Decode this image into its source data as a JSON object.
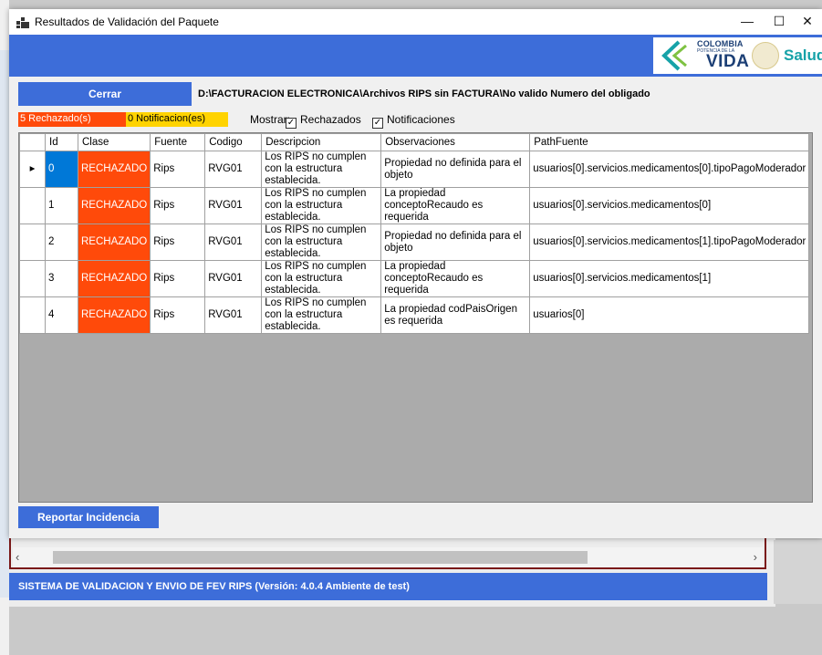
{
  "window": {
    "title": "Resultados de Validación del Paquete",
    "controls": {
      "minimize": "—",
      "maximize": "☐",
      "close": "✕"
    }
  },
  "logo": {
    "line1": "COLOMBIA",
    "line2": "POTENCIA DE LA",
    "line3": "VIDA",
    "ministry": "Salud"
  },
  "toolbar": {
    "close_label": "Cerrar",
    "path": "D:\\FACTURACION ELECTRONICA\\Archivos RIPS sin FACTURA\\No valido Numero del obligado"
  },
  "summary": {
    "rejected": "5 Rechazado(s)",
    "notifications": "0 Notificacion(es)",
    "show_label": "Mostrar:",
    "filter_rejected": "Rechazados",
    "filter_notifications": "Notificaciones",
    "rejected_color": "#ff4a0a",
    "notification_color": "#ffd300"
  },
  "table": {
    "columns": [
      "Id",
      "Clase",
      "Fuente",
      "Codigo",
      "Descripcion",
      "Observaciones",
      "PathFuente"
    ],
    "rows": [
      {
        "id": "0",
        "clase": "RECHAZADO",
        "fuente": "Rips",
        "codigo": "RVG01",
        "descripcion": "Los RIPS no cumplen con la estructura establecida.",
        "observaciones": "Propiedad no definida para el objeto",
        "path": "usuarios[0].servicios.medicamentos[0].tipoPagoModerador"
      },
      {
        "id": "1",
        "clase": "RECHAZADO",
        "fuente": "Rips",
        "codigo": "RVG01",
        "descripcion": "Los RIPS no cumplen con la estructura establecida.",
        "observaciones": "La propiedad conceptoRecaudo es requerida",
        "path": "usuarios[0].servicios.medicamentos[0]"
      },
      {
        "id": "2",
        "clase": "RECHAZADO",
        "fuente": "Rips",
        "codigo": "RVG01",
        "descripcion": "Los RIPS no cumplen con la estructura establecida.",
        "observaciones": "Propiedad no definida para el objeto",
        "path": "usuarios[0].servicios.medicamentos[1].tipoPagoModerador"
      },
      {
        "id": "3",
        "clase": "RECHAZADO",
        "fuente": "Rips",
        "codigo": "RVG01",
        "descripcion": "Los RIPS no cumplen con la estructura establecida.",
        "observaciones": "La propiedad conceptoRecaudo es requerida",
        "path": "usuarios[0].servicios.medicamentos[1]"
      },
      {
        "id": "4",
        "clase": "RECHAZADO",
        "fuente": "Rips",
        "codigo": "RVG01",
        "descripcion": "Los RIPS no cumplen con la estructura establecida.",
        "observaciones": "La propiedad codPaisOrigen es requerida",
        "path": "usuarios[0]"
      }
    ]
  },
  "footer": {
    "report_label": "Reportar Incidencia"
  },
  "background_app": {
    "status": "SISTEMA DE VALIDACION Y ENVIO DE FEV RIPS  (Versión: 4.0.4 Ambiente de test)",
    "scroll_left": "‹",
    "scroll_right": "›"
  },
  "colors": {
    "accent": "#3d6dd9",
    "selection": "#0078d7"
  }
}
